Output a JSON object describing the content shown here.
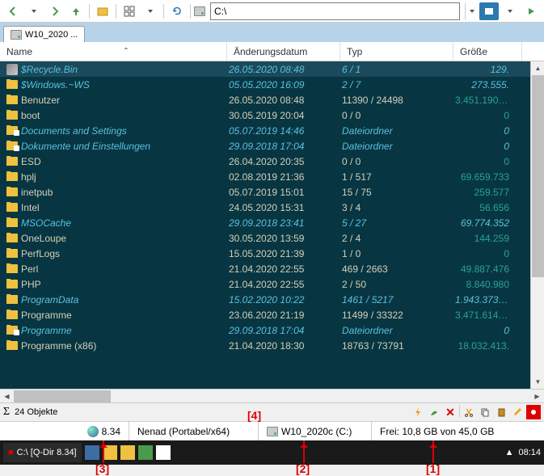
{
  "toolbar": {
    "address": "C:\\"
  },
  "tabs": {
    "items": [
      {
        "label": "W10_2020 ..."
      }
    ]
  },
  "columns": {
    "name": "Name",
    "date": "Änderungsdatum",
    "type": "Typ",
    "size": "Größe"
  },
  "files": [
    {
      "icon": "recycle",
      "name": "$Recycle.Bin",
      "date": "26.05.2020 08:48",
      "type": "6 / 1",
      "size": "129.",
      "style": "italic",
      "selected": true
    },
    {
      "icon": "folder",
      "name": "$Windows.~WS",
      "date": "05.05.2020 16:09",
      "type": "2 / 7",
      "size": "273.555.",
      "style": "italic"
    },
    {
      "icon": "folder",
      "name": "Benutzer",
      "date": "26.05.2020 08:48",
      "type": "11390 / 24498",
      "size": "3.451.190.3…",
      "style": "normal"
    },
    {
      "icon": "folder",
      "name": "boot",
      "date": "30.05.2019 20:04",
      "type": "0 / 0",
      "size": "0",
      "style": "normal"
    },
    {
      "icon": "folder-link",
      "name": "Documents and Settings",
      "date": "05.07.2019 14:46",
      "type": "Dateiordner",
      "size": "0",
      "style": "italic"
    },
    {
      "icon": "folder-link",
      "name": "Dokumente und Einstellungen",
      "date": "29.09.2018 17:04",
      "type": "Dateiordner",
      "size": "0",
      "style": "italic"
    },
    {
      "icon": "folder",
      "name": "ESD",
      "date": "26.04.2020 20:35",
      "type": "0 / 0",
      "size": "0",
      "style": "normal"
    },
    {
      "icon": "folder",
      "name": "hplj",
      "date": "02.08.2019 21:36",
      "type": "1 / 517",
      "size": "69.659.733",
      "style": "normal"
    },
    {
      "icon": "folder",
      "name": "inetpub",
      "date": "05.07.2019 15:01",
      "type": "15 / 75",
      "size": "259.577",
      "style": "normal"
    },
    {
      "icon": "folder",
      "name": "Intel",
      "date": "24.05.2020 15:31",
      "type": "3 / 4",
      "size": "56.656",
      "style": "normal"
    },
    {
      "icon": "folder",
      "name": "MSOCache",
      "date": "29.09.2018 23:41",
      "type": "5 / 27",
      "size": "69.774.352",
      "style": "italic"
    },
    {
      "icon": "folder",
      "name": "OneLoupe",
      "date": "30.05.2020 13:59",
      "type": "2 / 4",
      "size": "144.259",
      "style": "normal"
    },
    {
      "icon": "folder",
      "name": "PerfLogs",
      "date": "15.05.2020 21:39",
      "type": "1 / 0",
      "size": "0",
      "style": "normal"
    },
    {
      "icon": "folder",
      "name": "Perl",
      "date": "21.04.2020 22:55",
      "type": "469 / 2663",
      "size": "49.887.476",
      "style": "normal"
    },
    {
      "icon": "folder",
      "name": "PHP",
      "date": "21.04.2020 22:55",
      "type": "2 / 50",
      "size": "8.840.980",
      "style": "normal"
    },
    {
      "icon": "folder",
      "name": "ProgramData",
      "date": "15.02.2020 10:22",
      "type": "1461 / 5217",
      "size": "1.943.373.3…",
      "style": "italic"
    },
    {
      "icon": "folder",
      "name": "Programme",
      "date": "23.06.2020 21:19",
      "type": "11499 / 33322",
      "size": "3.471.614.3…",
      "style": "normal"
    },
    {
      "icon": "folder-link",
      "name": "Programme",
      "date": "29.09.2018 17:04",
      "type": "Dateiordner",
      "size": "0",
      "style": "italic"
    },
    {
      "icon": "folder",
      "name": "Programme (x86)",
      "date": "21.04.2020 18:30",
      "type": "18763 / 73791",
      "size": "18.032.413.",
      "style": "normal"
    }
  ],
  "status1": {
    "objects": "24 Objekte"
  },
  "status2": {
    "version": "8.34",
    "user": "Nenad (Portabel/x64)",
    "volume": "W10_2020c (C:)",
    "free": "Frei: 10,8 GB von 45,0 GB"
  },
  "taskbar": {
    "app": "C:\\  [Q-Dir 8.34]",
    "clock": "08:14"
  },
  "annotations": {
    "a1": "[1]",
    "a2": "[2]",
    "a3": "[3]",
    "a4": "[4]"
  }
}
